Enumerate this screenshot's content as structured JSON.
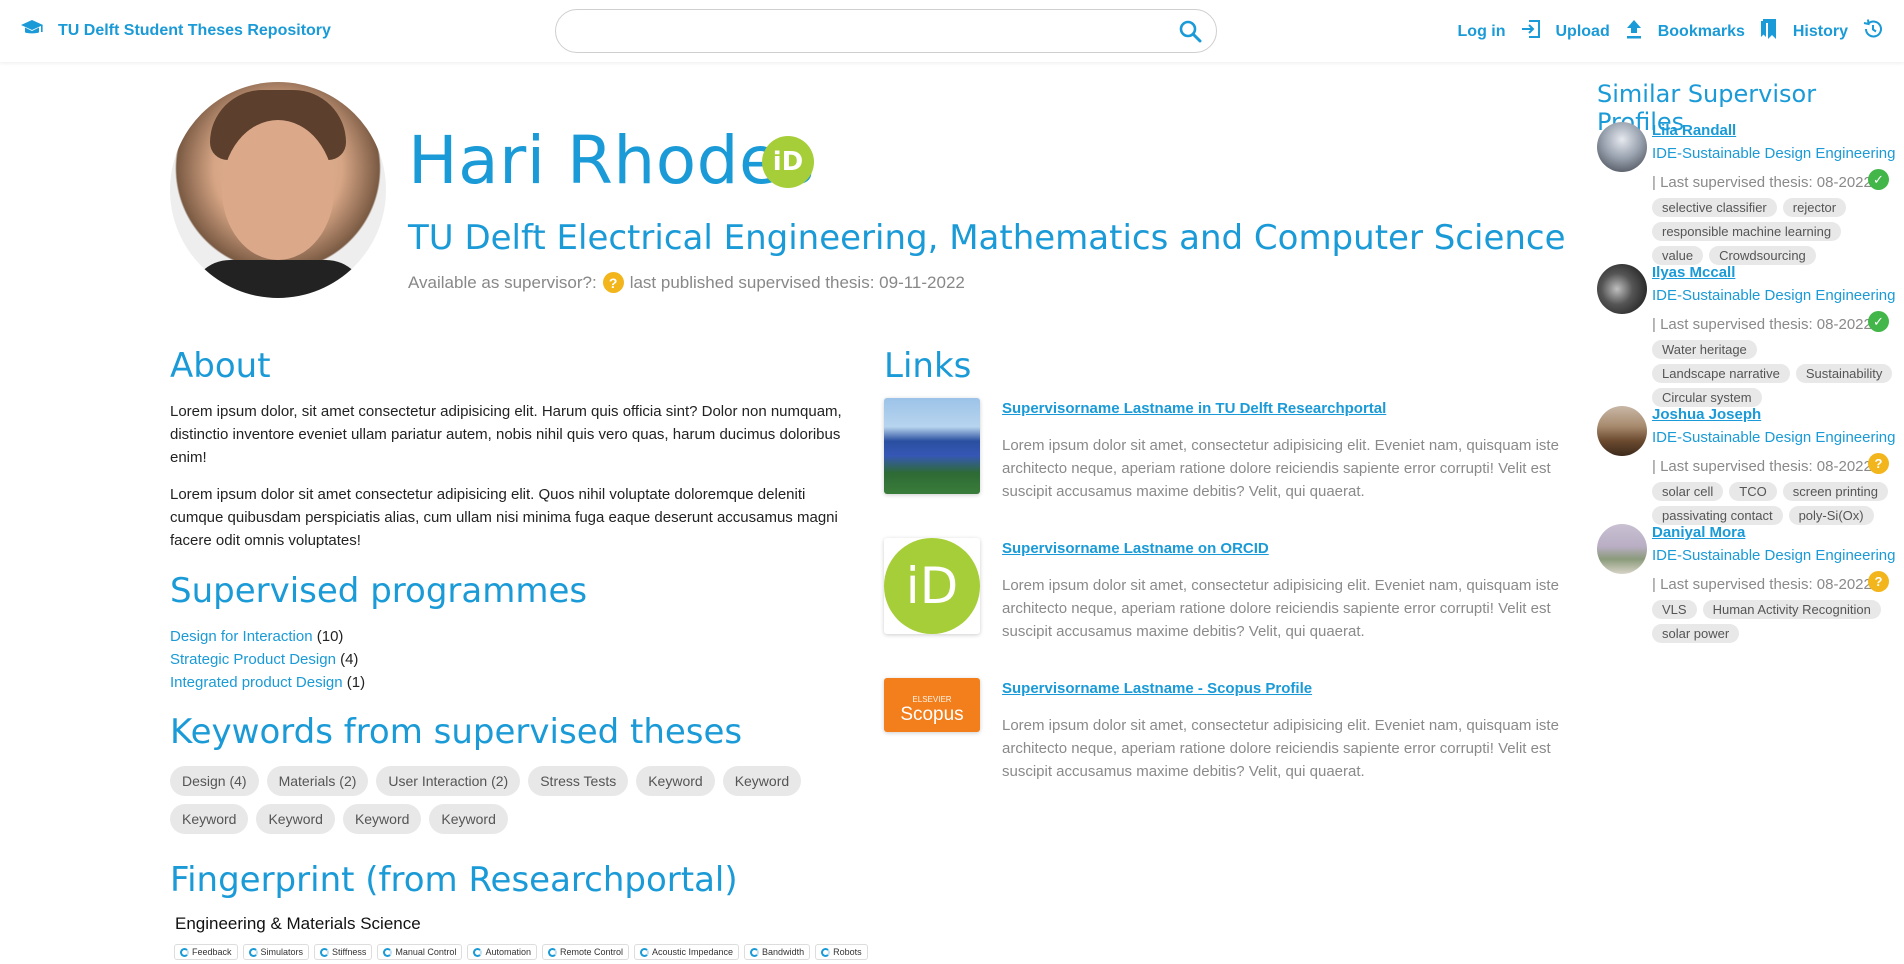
{
  "header": {
    "brand_title": "TU Delft Student Theses Repository",
    "search_value": "",
    "nav": [
      {
        "label": "Log in",
        "icon": "login-icon"
      },
      {
        "label": "Upload",
        "icon": "upload-icon"
      },
      {
        "label": "Bookmarks",
        "icon": "bookmark-icon"
      },
      {
        "label": "History",
        "icon": "history-icon"
      }
    ]
  },
  "profile": {
    "name": "Hari Rhodes",
    "orcid_badge": "iD",
    "faculty": "TU Delft Electrical Engineering, Mathematics and Computer Science",
    "available_label": "Available as supervisor?:",
    "available_icon": "?",
    "last_thesis": "last published supervised thesis: 09-11-2022"
  },
  "about": {
    "title": "About",
    "p1": "Lorem ipsum dolor, sit amet consectetur adipisicing elit. Harum quis officia sint? Dolor non numquam, distinctio inventore eveniet ullam pariatur autem, nobis nihil quis vero quas, harum ducimus doloribus enim!",
    "p2": "Lorem ipsum dolor sit amet consectetur adipisicing elit. Quos nihil voluptate doloremque deleniti cumque quibusdam perspiciatis alias, cum ullam nisi minima fuga eaque deserunt accusamus magni facere odit omnis voluptates!"
  },
  "programmes": {
    "title": "Supervised programmes",
    "items": [
      {
        "name": "Design for Interaction",
        "count": "(10)"
      },
      {
        "name": "Strategic Product Design",
        "count": "(4)"
      },
      {
        "name": "Integrated product Design",
        "count": "(1)"
      }
    ]
  },
  "keywords": {
    "title": "Keywords from supervised theses",
    "items": [
      "Design (4)",
      "Materials (2)",
      "User Interaction (2)",
      "Stress Tests",
      "Keyword",
      "Keyword",
      "Keyword",
      "Keyword",
      "Keyword",
      "Keyword"
    ]
  },
  "fingerprint": {
    "title": "Fingerprint (from Researchportal)",
    "subtitle": "Engineering & Materials Science",
    "items": [
      "Feedback",
      "Simulators",
      "Stiffness",
      "Manual Control",
      "Automation",
      "Remote Control",
      "Acoustic Impedance",
      "Bandwidth",
      "Robots"
    ]
  },
  "links": {
    "title": "Links",
    "items": [
      {
        "title": "Supervisorname Lastname in TU Delft Researchportal",
        "desc": "Lorem ipsum dolor sit amet, consectetur adipisicing elit. Eveniet nam, quisquam iste architecto neque, aperiam ratione dolore reiciendis sapiente error corrupti! Velit est suscipit accusamus maxime debitis? Velit, qui quaerat."
      },
      {
        "title": "Supervisorname Lastname on ORCID",
        "desc": "Lorem ipsum dolor sit amet, consectetur adipisicing elit. Eveniet nam, quisquam iste architecto neque, aperiam ratione dolore reiciendis sapiente error corrupti! Velit est suscipit accusamus maxime debitis? Velit, qui quaerat."
      },
      {
        "title": "Supervisorname Lastname - Scopus Profile",
        "desc": "Lorem ipsum dolor sit amet, consectetur adipisicing elit. Eveniet nam, quisquam iste architecto neque, aperiam ratione dolore reiciendis sapiente error corrupti! Velit est suscipit accusamus maxime debitis? Velit, qui quaerat."
      }
    ],
    "orcid_logo": "iD",
    "scopus_sub": "ELSEVIER",
    "scopus_logo": "Scopus"
  },
  "similar": {
    "title": "Similar Supervisor Profiles",
    "profiles": [
      {
        "name": "Lila Randall",
        "dept": "IDE-Sustainable Design Engineering",
        "last": "| Last supervised thesis: 08-2022",
        "status": "available",
        "status_glyph": "✓",
        "tags": [
          "selective classifier",
          "rejector",
          "responsible machine learning",
          "value",
          "Crowdsourcing"
        ]
      },
      {
        "name": "Ilyas Mccall",
        "dept": "IDE-Sustainable Design Engineering",
        "last": "| Last supervised thesis: 08-2022",
        "status": "available",
        "status_glyph": "✓",
        "tags": [
          "Water heritage",
          "Landscape narrative",
          "Sustainability",
          "Circular system"
        ]
      },
      {
        "name": "Joshua Joseph",
        "dept": "IDE-Sustainable Design Engineering",
        "last": "| Last supervised thesis: 08-2022",
        "status": "unknown",
        "status_glyph": "?",
        "tags": [
          "solar cell",
          "TCO",
          "screen printing",
          "passivating contact",
          "poly-Si(Ox)"
        ]
      },
      {
        "name": "Daniyal Mora",
        "dept": "IDE-Sustainable Design Engineering",
        "last": "| Last supervised thesis: 08-2022",
        "status": "unknown",
        "status_glyph": "?",
        "tags": [
          "VLS",
          "Human Activity Recognition",
          "solar power"
        ]
      }
    ]
  },
  "colors": {
    "accent": "#1a9ad6",
    "orcid": "#a6ce39",
    "scopus": "#f37f1c",
    "ok": "#43b649",
    "unknown": "#f2b51c"
  }
}
